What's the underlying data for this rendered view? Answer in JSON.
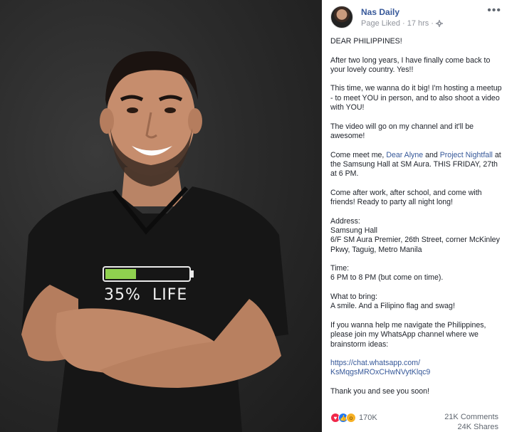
{
  "photo": {
    "shirt_percent": "35%",
    "shirt_word": "LIFE",
    "battery_level": 0.35,
    "battery_color": "#8fd14f"
  },
  "post": {
    "author": "Nas Daily",
    "status": "Page Liked",
    "time": "17 hrs",
    "privacy_icon": "gear-icon",
    "more_label": "•••",
    "paragraphs": {
      "p1": "DEAR PHILIPPINES!",
      "p2": "After two long years, I have finally come back to your lovely country. Yes!!",
      "p3": "This time, we wanna do it big! I'm hosting a meetup - to meet YOU in person, and to also shoot a video with YOU!",
      "p4": "The video will go on my channel and it'll be awesome!",
      "p5_a": "Come meet me, ",
      "p5_link1": "Dear Alyne",
      "p5_b": " and ",
      "p5_link2": "Project Nightfall",
      "p5_c": " at the Samsung Hall at SM Aura. THIS FRIDAY, 27th at 6 PM.",
      "p6": "Come after work, after school, and come with friends! Ready to party all night long!",
      "address_label": "Address:",
      "address_1": "Samsung Hall",
      "address_2": "6/F SM Aura Premier, 26th Street, corner McKinley Pkwy, Taguig, Metro Manila",
      "time_label": "Time:",
      "time_value": "6 PM to 8 PM (but come on time).",
      "bring_label": "What to bring:",
      "bring_value": "A smile. And a Filipino flag and swag!",
      "help": "If you wanna help me navigate the Philippines, please join my WhatsApp channel where we brainstorm ideas:",
      "whatsapp_1": "https://chat.whatsapp.com/",
      "whatsapp_2": "KsMqgsMROxCHwNVytKlqc9",
      "thanks": "Thank you and see you soon!"
    },
    "reactions": {
      "icons": [
        "love-icon",
        "like-icon",
        "wow-icon"
      ],
      "count": "170K"
    },
    "comments": "21K Comments",
    "shares": "24K Shares",
    "link_color": "#365899"
  }
}
